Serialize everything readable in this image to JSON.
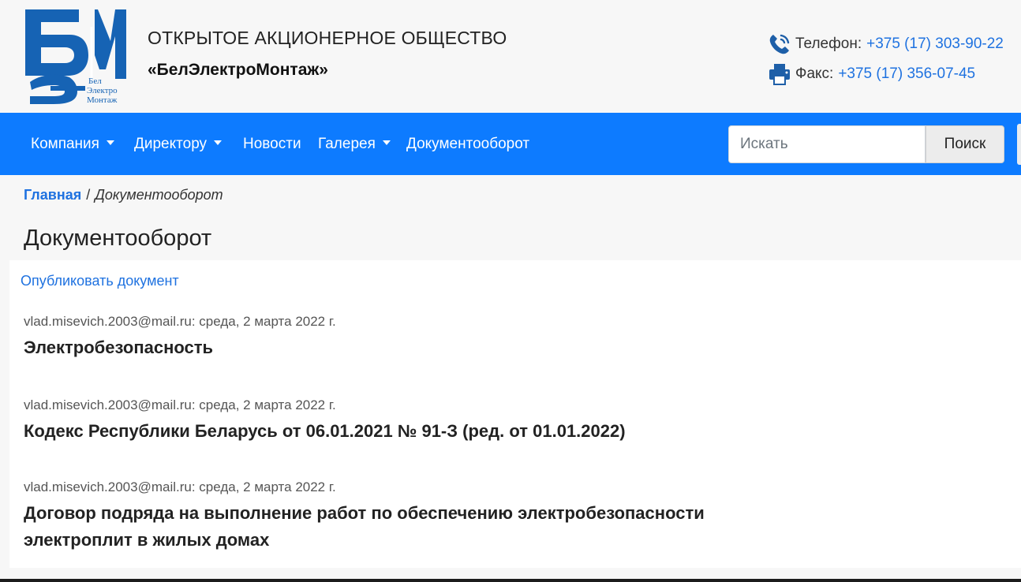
{
  "header": {
    "company_line1": "ОТКРЫТОЕ АКЦИОНЕРНОЕ ОБЩЕСТВО",
    "company_line2": "«БелЭлектроМонтаж»",
    "logo_text": [
      "Бел",
      "Электро",
      "Монтаж"
    ],
    "phone_label": "Телефон:",
    "phone_value": "+375 (17) 303-90-22",
    "fax_label": "Факс:",
    "fax_value": "+375 (17) 356-07-45",
    "phone_icon": "phone-icon",
    "fax_icon": "fax-icon"
  },
  "navbar": {
    "items": [
      {
        "label": "Компания",
        "dropdown": true
      },
      {
        "label": "Директору",
        "dropdown": true
      },
      {
        "label": "Новости",
        "dropdown": false
      },
      {
        "label": "Галерея",
        "dropdown": true
      },
      {
        "label": "Документооборот",
        "dropdown": false
      }
    ],
    "search_placeholder": "Искать",
    "search_button": "Поиск"
  },
  "breadcrumb": {
    "home": "Главная",
    "separator": "/",
    "current": "Документооборот"
  },
  "page_title": "Документооборот",
  "content": {
    "publish_link": "Опубликовать документ",
    "documents": [
      {
        "meta": "vlad.misevich.2003@mail.ru: среда, 2 марта 2022 г.",
        "title": "Электробезопасность"
      },
      {
        "meta": "vlad.misevich.2003@mail.ru: среда, 2 марта 2022 г.",
        "title": "Кодекс Республики Беларусь от 06.01.2021 № 91-З (ред. от 01.01.2022)"
      },
      {
        "meta": "vlad.misevich.2003@mail.ru: среда, 2 марта 2022 г.",
        "title_line1": "Договор подряда на выполнение работ по обеспечению электробезопасности",
        "title_line2": "электроплит в жилых домах"
      }
    ]
  },
  "colors": {
    "navbar": "#0d7bff",
    "link": "#1f72e0",
    "logo": "#1663b4"
  }
}
